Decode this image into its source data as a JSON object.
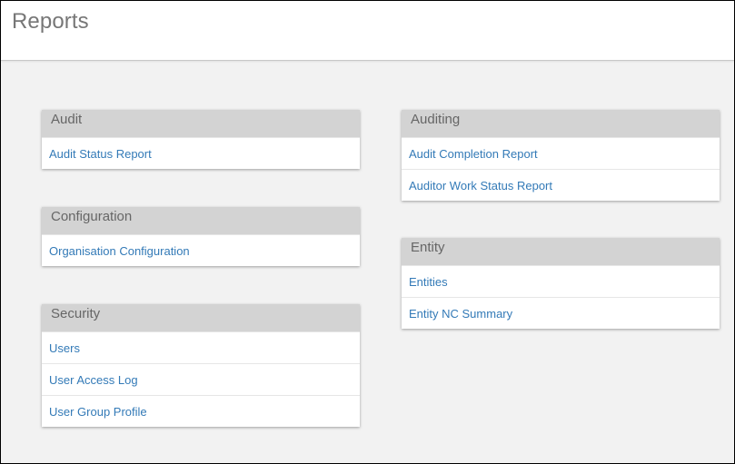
{
  "header": {
    "title": "Reports"
  },
  "columns": {
    "left": [
      {
        "title": "Audit",
        "items": [
          "Audit Status Report"
        ]
      },
      {
        "title": "Configuration",
        "items": [
          "Organisation Configuration"
        ]
      },
      {
        "title": "Security",
        "items": [
          "Users",
          "User Access Log",
          "User Group Profile"
        ]
      }
    ],
    "right": [
      {
        "title": "Auditing",
        "items": [
          "Audit Completion Report",
          "Auditor Work Status Report"
        ]
      },
      {
        "title": "Entity",
        "items": [
          "Entities",
          "Entity NC Summary"
        ]
      }
    ]
  },
  "colors": {
    "link": "#337ab7",
    "card_header_bg": "#d3d3d3",
    "page_bg": "#f2f2f2"
  }
}
